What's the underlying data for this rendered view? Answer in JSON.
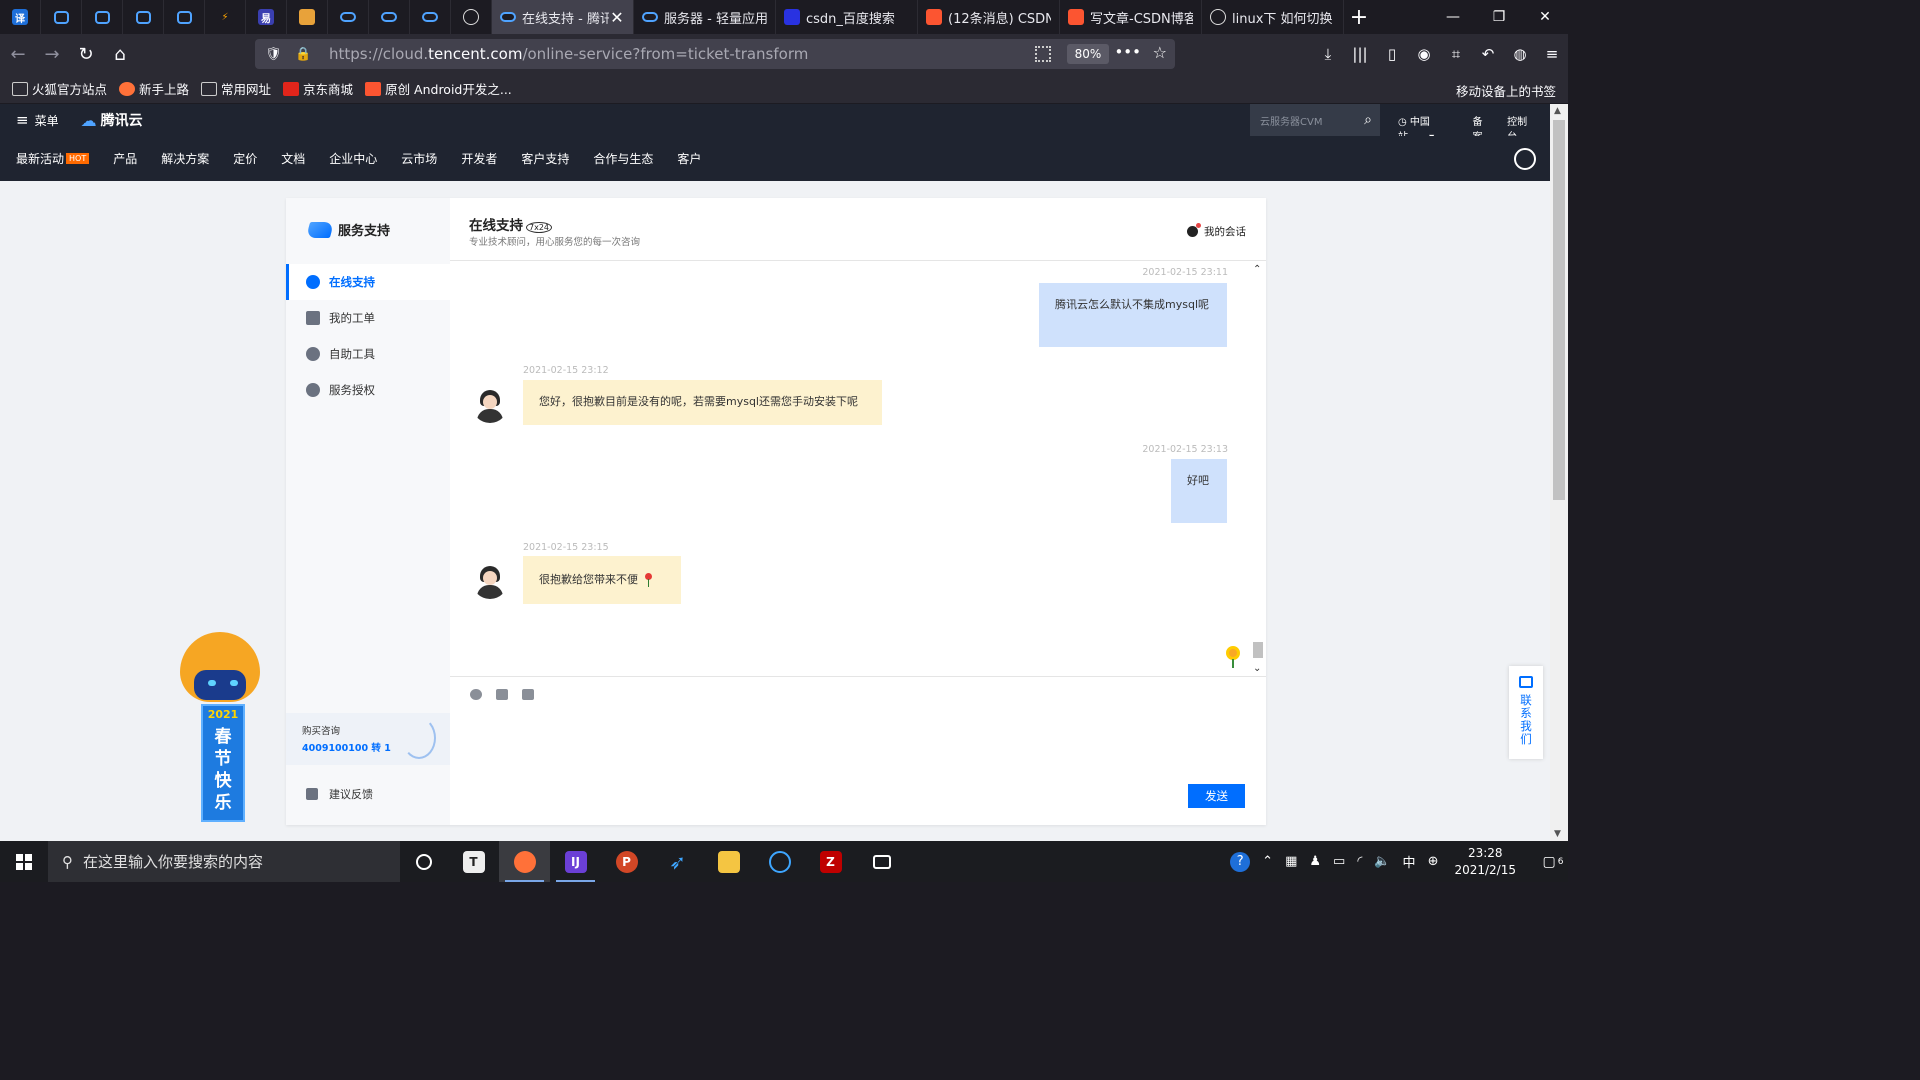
{
  "browser": {
    "pinned_tabs": [
      {
        "icon": "translate-icon",
        "glyph": "译",
        "color": "#1e6fd9"
      },
      {
        "icon": "bilibili-icon",
        "glyph": "",
        "color": "#1c1b22"
      },
      {
        "icon": "bilibili-icon",
        "glyph": "",
        "color": "#1c1b22"
      },
      {
        "icon": "bilibili-icon",
        "glyph": "",
        "color": "#1c1b22"
      },
      {
        "icon": "bilibili-icon",
        "glyph": "",
        "color": "#1c1b22"
      },
      {
        "icon": "lightning-icon",
        "glyph": "⚡",
        "color": "#1c1b22"
      },
      {
        "icon": "app-icon",
        "glyph": "易",
        "color": "#3a3fb0"
      },
      {
        "icon": "fruit-icon",
        "glyph": "",
        "color": "#e8a23a"
      },
      {
        "icon": "tencent-cloud-icon",
        "glyph": "",
        "color": "#1c1b22"
      },
      {
        "icon": "tencent-cloud-icon",
        "glyph": "",
        "color": "#1c1b22"
      },
      {
        "icon": "tencent-cloud-icon",
        "glyph": "",
        "color": "#1c1b22"
      },
      {
        "icon": "wolf-icon",
        "glyph": "",
        "color": "#1c1b22"
      }
    ],
    "tabs": [
      {
        "title": "在线支持 - 腾讯",
        "icon": "tencent-cloud-icon",
        "active": true,
        "close": "✕"
      },
      {
        "title": "服务器 - 轻量应用",
        "icon": "tencent-cloud-icon",
        "active": false
      },
      {
        "title": "csdn_百度搜索",
        "icon": "baidu-icon",
        "active": false
      },
      {
        "title": "(12条消息) CSDN",
        "icon": "csdn-icon",
        "active": false
      },
      {
        "title": "写文章-CSDN博客",
        "icon": "csdn-icon",
        "active": false
      },
      {
        "title": "linux下 如何切换",
        "icon": "wolf-icon",
        "active": false
      }
    ],
    "url_host": "https://cloud.",
    "url_domain": "tencent.com",
    "url_path": "/online-service?from=ticket-transform",
    "zoom": "80%",
    "bookmarks": [
      {
        "label": "火狐官方站点",
        "icon": "folder-icon"
      },
      {
        "label": "新手上路",
        "icon": "firefox-icon"
      },
      {
        "label": "常用网址",
        "icon": "folder-icon"
      },
      {
        "label": "京东商城",
        "icon": "jd-icon"
      },
      {
        "label": "原创 Android开发之...",
        "icon": "csdn-icon"
      }
    ],
    "mobile_bookmarks": "移动设备上的书签"
  },
  "tencent": {
    "menu": "菜单",
    "brand": "腾讯云",
    "search_placeholder": "云服务器CVM",
    "region": "中国站",
    "beian": "备案",
    "console": "控制台",
    "nav": [
      "最新活动",
      "产品",
      "解决方案",
      "定价",
      "文档",
      "企业中心",
      "云市场",
      "开发者",
      "客户支持",
      "合作与生态",
      "客户"
    ],
    "hot_badge": "HOT"
  },
  "sidebar": {
    "title": "服务支持",
    "items": [
      {
        "label": "在线支持",
        "active": true
      },
      {
        "label": "我的工单",
        "active": false
      },
      {
        "label": "自助工具",
        "active": false
      },
      {
        "label": "服务授权",
        "active": false
      }
    ],
    "buy_label": "购买咨询",
    "buy_number": "4009100100 转 1",
    "feedback": "建议反馈"
  },
  "chat": {
    "title": "在线支持",
    "badge_24": "7x24",
    "subtitle": "专业技术顾问，用心服务您的每一次咨询",
    "my_sessions": "我的会话",
    "messages": [
      {
        "from": "user",
        "time": "2021-02-15 23:11",
        "text": "腾讯云怎么默认不集成mysql呢"
      },
      {
        "from": "agent",
        "time": "2021-02-15 23:12",
        "text": "您好，很抱歉目前是没有的呢，若需要mysql还需您手动安装下呢"
      },
      {
        "from": "user",
        "time": "2021-02-15 23:13",
        "text": "好吧"
      },
      {
        "from": "agent",
        "time": "2021-02-15 23:15",
        "text": "很抱歉给您带来不便"
      }
    ],
    "send": "发送"
  },
  "banner": {
    "year": "2021",
    "chars": [
      "春",
      "节",
      "快",
      "乐"
    ]
  },
  "contact": "联系我们",
  "taskbar": {
    "search_placeholder": "在这里输入你要搜索的内容",
    "ime": "中",
    "time": "23:28",
    "date": "2021/2/15",
    "notifications": "6"
  }
}
